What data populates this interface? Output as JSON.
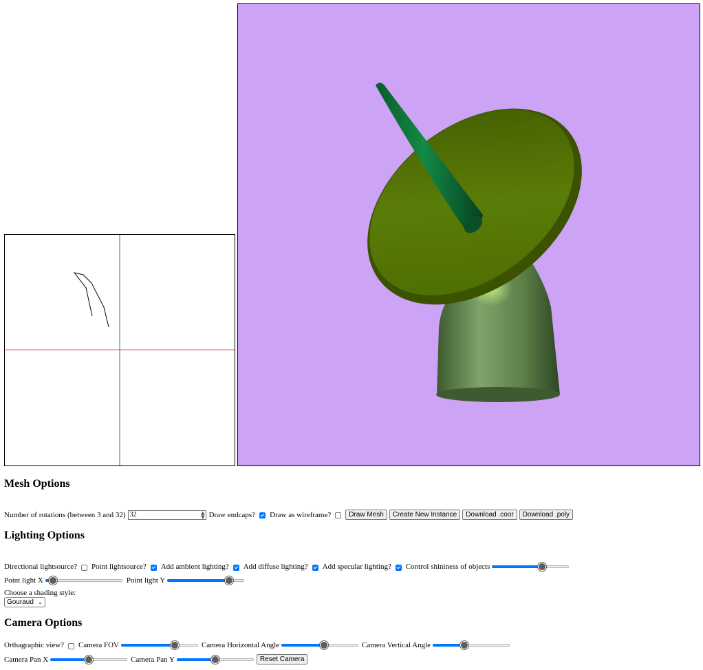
{
  "colors": {
    "viewport_bg": "#cca3f5",
    "dish_color": "#4f6e00",
    "feed_color": "#0b6a32",
    "pedestal_color": "#6b8f55",
    "x_axis": "#e06666",
    "y_axis": "#2e8b3e",
    "accent": "#0075ff"
  },
  "mesh": {
    "heading": "Mesh Options",
    "rotations_label": "Number of rotations (between 3 and 32)",
    "rotations_value": "32",
    "endcaps_label": "Draw endcaps?",
    "endcaps_checked": true,
    "wireframe_label": "Draw as wireframe?",
    "wireframe_checked": false,
    "draw_mesh": "Draw Mesh",
    "create_instance": "Create New Instance",
    "download_coor": "Download .coor",
    "download_poly": "Download .poly"
  },
  "lighting": {
    "heading": "Lighting Options",
    "directional_label": "Directional lightsource?",
    "directional_checked": false,
    "point_label": "Point lightsource?",
    "point_checked": true,
    "ambient_label": "Add ambient lighting?",
    "ambient_checked": true,
    "diffuse_label": "Add diffuse lighting?",
    "diffuse_checked": true,
    "specular_label": "Add specular lighting?",
    "specular_checked": true,
    "shininess_label": "Control shininess of objects",
    "shininess_value": 0.65,
    "point_x_label": "Point light X",
    "point_x_value": 0.1,
    "point_y_label": "Point light Y",
    "point_y_value": 0.8,
    "shading_label": "Choose a shading style:",
    "shading_value": "Gouraud"
  },
  "camera": {
    "heading": "Camera Options",
    "ortho_label": "Orthagraphic view?",
    "ortho_checked": false,
    "fov_label": "Camera FOV",
    "fov_value": 0.7,
    "hangle_label": "Camera Horizontal Angle",
    "hangle_value": 0.55,
    "vangle_label": "Camera Vertical Angle",
    "vangle_value": 0.41,
    "panx_label": "Camera Pan X",
    "panx_value": 0.5,
    "pany_label": "Camera Pan Y",
    "pany_value": 0.5,
    "reset": "Reset Camera"
  }
}
